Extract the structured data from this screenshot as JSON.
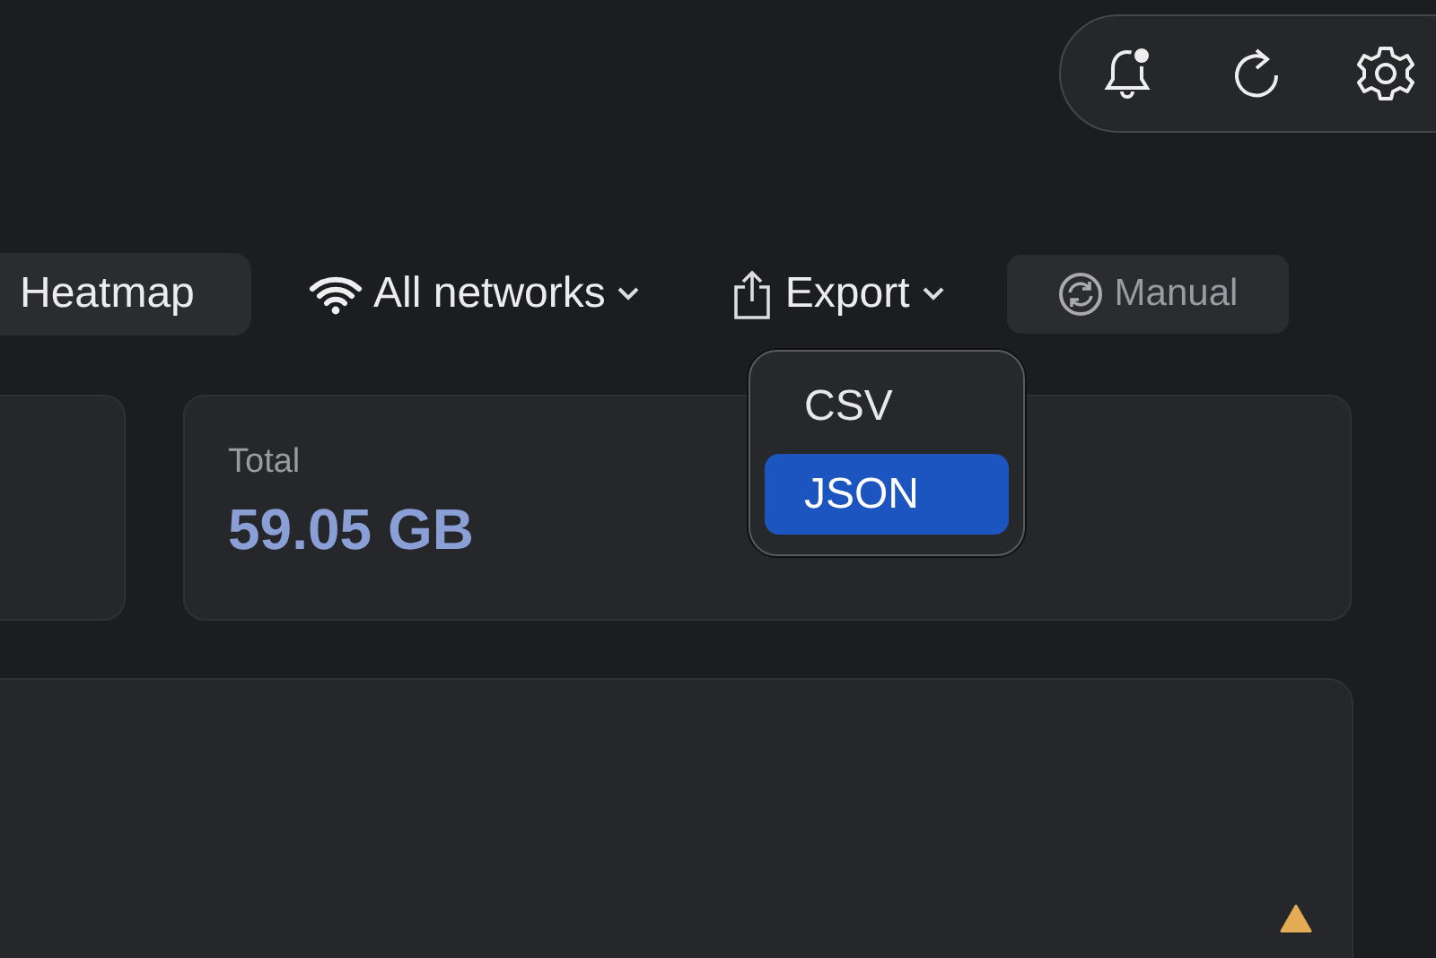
{
  "toolbar": {
    "view_button": {
      "label": "Heatmap"
    },
    "network_filter": {
      "label": "All networks"
    },
    "export_menu": {
      "label": "Export",
      "options": [
        {
          "label": "CSV",
          "selected": false
        },
        {
          "label": "JSON",
          "selected": true
        }
      ]
    },
    "refresh_button": {
      "label": "Manual"
    }
  },
  "stats": [
    {
      "label": "Total",
      "value": "59.05 GB"
    }
  ]
}
